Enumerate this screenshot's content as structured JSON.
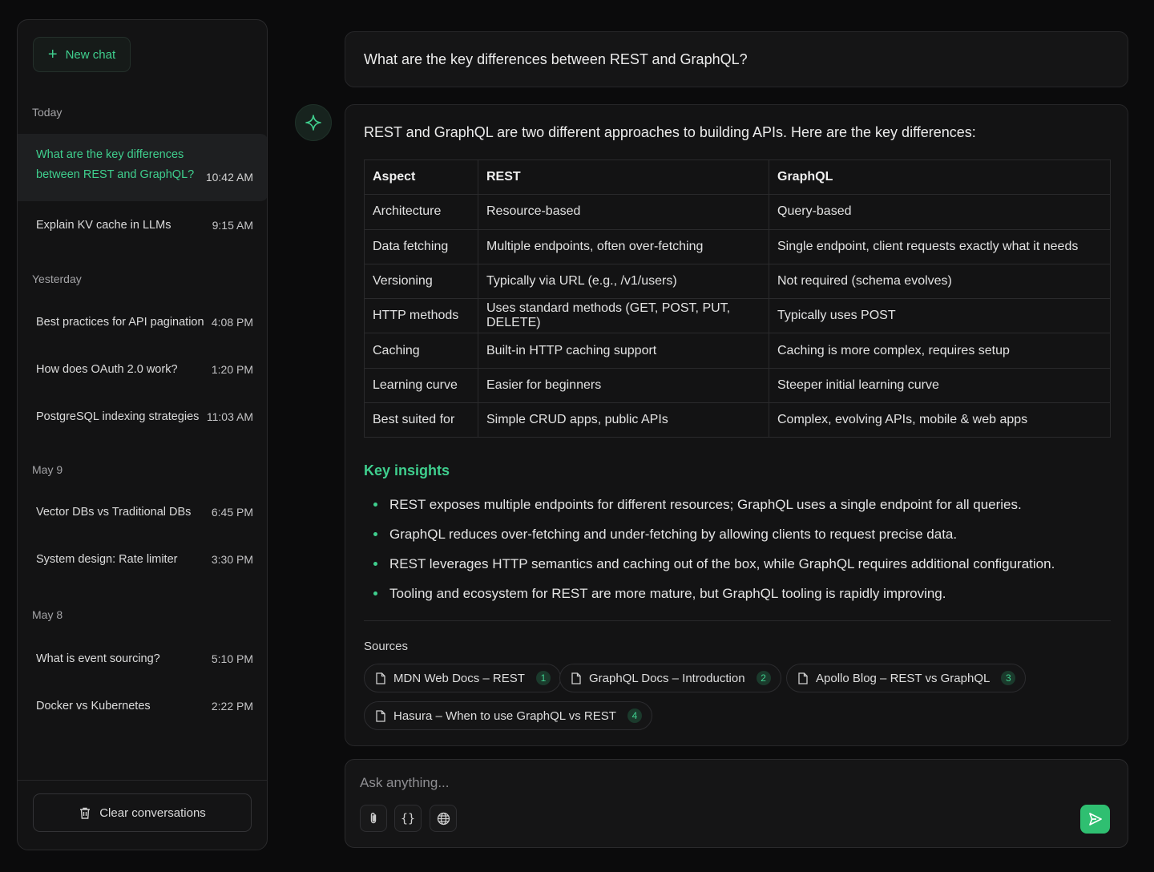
{
  "sidebar": {
    "new_chat_label": "New chat",
    "groups": {
      "today": "Today",
      "yesterday": "Yesterday",
      "may9": "May 9",
      "may8": "May 8"
    },
    "conversations": [
      {
        "title": "What are the key differences between REST and GraphQL?",
        "time": "10:42 AM"
      },
      {
        "title": "Explain KV cache in LLMs",
        "time": "9:15 AM"
      },
      {
        "title": "Best practices for API pagination",
        "time": "4:08 PM"
      },
      {
        "title": "How does OAuth 2.0 work?",
        "time": "1:20 PM"
      },
      {
        "title": "PostgreSQL indexing strategies",
        "time": "11:03 AM"
      },
      {
        "title": "Vector DBs vs Traditional DBs",
        "time": "6:45 PM"
      },
      {
        "title": "System design: Rate limiter",
        "time": "3:30 PM"
      },
      {
        "title": "What is event sourcing?",
        "time": "5:10 PM"
      },
      {
        "title": "Docker vs Kubernetes",
        "time": "2:22 PM"
      }
    ],
    "clear_label": "Clear conversations"
  },
  "chat": {
    "user_message": "What are the key differences between REST and GraphQL?",
    "intro": "REST and GraphQL are two different approaches to building APIs. Here are the key differences:",
    "table": {
      "headers": [
        "Aspect",
        "REST",
        "GraphQL"
      ],
      "rows": [
        [
          "Architecture",
          "Resource-based",
          "Query-based"
        ],
        [
          "Data fetching",
          "Multiple endpoints, often over-fetching",
          "Single endpoint, client requests exactly what it needs"
        ],
        [
          "Versioning",
          "Typically via URL (e.g., /v1/users)",
          "Not required (schema evolves)"
        ],
        [
          "HTTP methods",
          "Uses standard methods (GET, POST, PUT, DELETE)",
          "Typically uses POST"
        ],
        [
          "Caching",
          "Built-in HTTP caching support",
          "Caching is more complex, requires setup"
        ],
        [
          "Learning curve",
          "Easier for beginners",
          "Steeper initial learning curve"
        ],
        [
          "Best suited for",
          "Simple CRUD apps, public APIs",
          "Complex, evolving APIs, mobile & web apps"
        ]
      ]
    },
    "insights_title": "Key insights",
    "insights": [
      "REST exposes multiple endpoints for different resources; GraphQL uses a single endpoint for all queries.",
      "GraphQL reduces over-fetching and under-fetching by allowing clients to request precise data.",
      "REST leverages HTTP semantics and caching out of the box, while GraphQL requires additional configuration.",
      "Tooling and ecosystem for REST are more mature, but GraphQL tooling is rapidly improving."
    ],
    "sources_label": "Sources",
    "sources": [
      {
        "title": "MDN Web Docs – REST",
        "num": "1"
      },
      {
        "title": "GraphQL Docs – Introduction",
        "num": "2"
      },
      {
        "title": "Apollo Blog – REST vs GraphQL",
        "num": "3"
      },
      {
        "title": "Hasura – When to use GraphQL vs REST",
        "num": "4"
      }
    ]
  },
  "composer": {
    "placeholder": "Ask anything...",
    "code_glyph": "{}",
    "icons": [
      "paperclip-icon",
      "code-icon",
      "globe-icon",
      "send-icon"
    ]
  },
  "colors": {
    "accent": "#3fcf8e",
    "send_button": "#2fbf71",
    "background": "#0b0b0c",
    "panel": "#131314"
  }
}
